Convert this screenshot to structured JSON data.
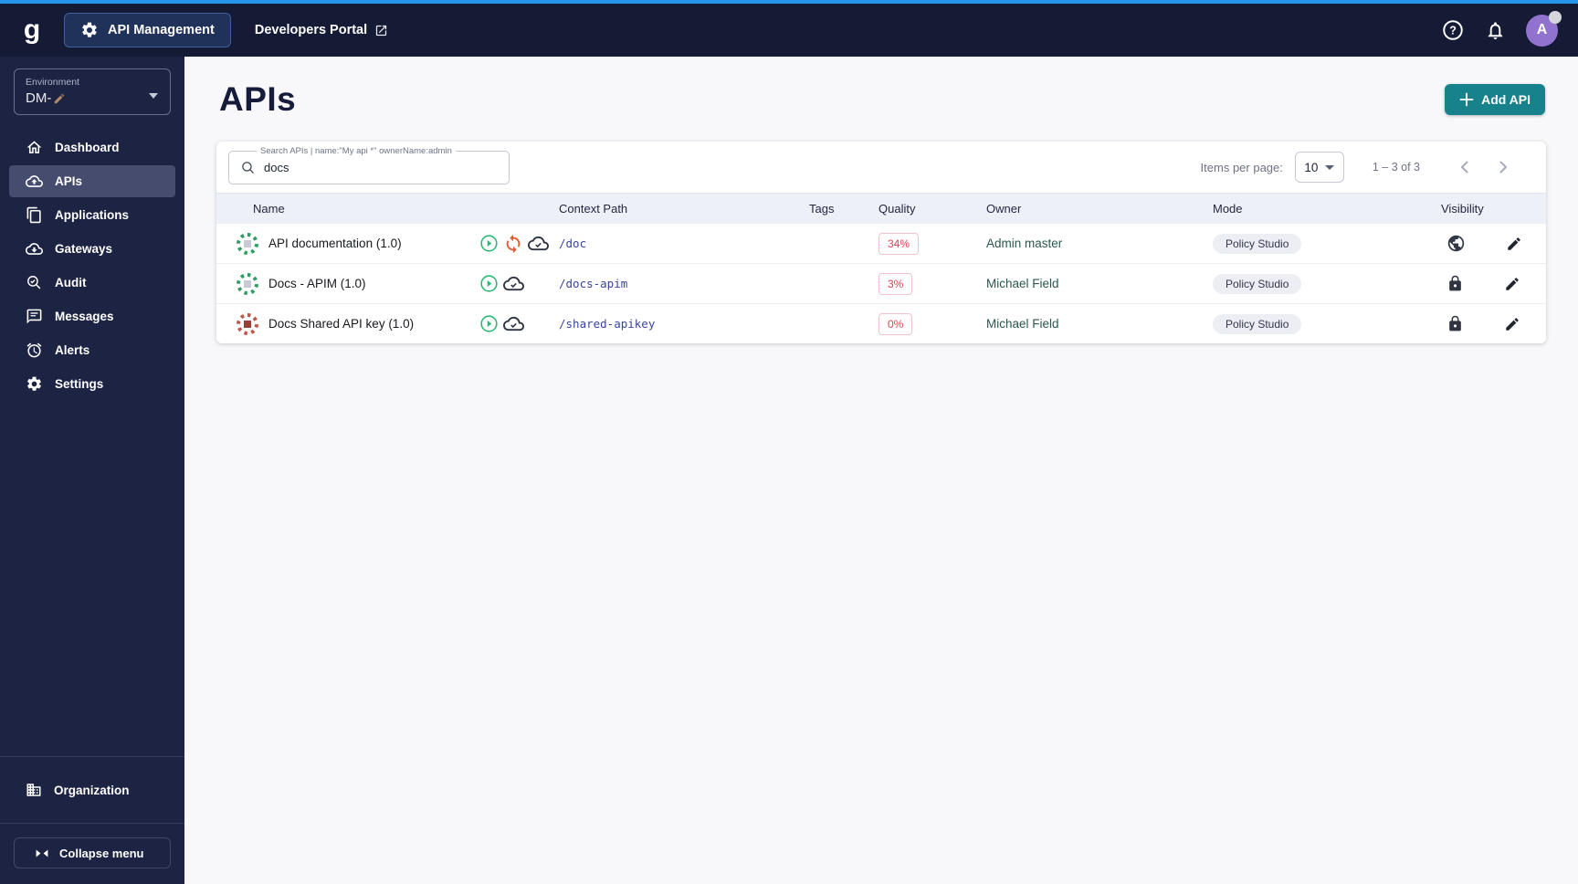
{
  "topbar": {
    "logo": "g",
    "api_management_label": "API Management",
    "developers_portal_label": "Developers Portal",
    "avatar_initial": "A"
  },
  "sidebar": {
    "environment_label": "Environment",
    "environment_value": "DM-",
    "items": [
      {
        "label": "Dashboard",
        "icon": "home-icon",
        "selected": false
      },
      {
        "label": "APIs",
        "icon": "cloud-upload-icon",
        "selected": true
      },
      {
        "label": "Applications",
        "icon": "copy-icon",
        "selected": false
      },
      {
        "label": "Gateways",
        "icon": "cloud-download-icon",
        "selected": false
      },
      {
        "label": "Audit",
        "icon": "search-check-icon",
        "selected": false
      },
      {
        "label": "Messages",
        "icon": "message-icon",
        "selected": false
      },
      {
        "label": "Alerts",
        "icon": "alarm-icon",
        "selected": false
      },
      {
        "label": "Settings",
        "icon": "gear-icon",
        "selected": false
      }
    ],
    "organization_label": "Organization",
    "collapse_label": "Collapse menu"
  },
  "main": {
    "title": "APIs",
    "add_api_label": "Add API",
    "search": {
      "label": "Search APIs | name:\"My api *\" ownerName:admin",
      "value": "docs"
    },
    "pagination": {
      "items_per_page_label": "Items per page:",
      "items_per_page_value": "10",
      "range": "1 – 3 of 3"
    }
  },
  "table": {
    "columns": [
      "Name",
      "Context Path",
      "Tags",
      "Quality",
      "Owner",
      "Mode",
      "Visibility"
    ],
    "rows": [
      {
        "name": "API documentation (1.0)",
        "context_path": "/doc",
        "tags": "",
        "quality": "34%",
        "owner": "Admin master",
        "mode": "Policy Studio",
        "visibility": "public",
        "statuses": [
          "started-icon",
          "out-of-sync-icon",
          "deployed-icon"
        ]
      },
      {
        "name": "Docs - APIM (1.0)",
        "context_path": "/docs-apim",
        "tags": "",
        "quality": "3%",
        "owner": "Michael Field",
        "mode": "Policy Studio",
        "visibility": "private",
        "statuses": [
          "started-icon",
          "deployed-icon"
        ]
      },
      {
        "name": "Docs Shared API key (1.0)",
        "context_path": "/shared-apikey",
        "tags": "",
        "quality": "0%",
        "owner": "Michael Field",
        "mode": "Policy Studio",
        "visibility": "private",
        "statuses": [
          "started-icon",
          "deployed-icon"
        ]
      }
    ]
  },
  "colors": {
    "topbar_accent_blue": "#2796e8",
    "topbar_bg": "#151b35",
    "sidebar_bg": "#1d2342",
    "accent_teal_button": "#17828b",
    "quality_red": "#df4156",
    "owner_green": "#2b584e",
    "context_path_blue": "#3a449e",
    "avatar_purple": "#9173cf",
    "status_started_green": "#2ab873",
    "status_out_of_sync_orange": "#e7562e"
  }
}
